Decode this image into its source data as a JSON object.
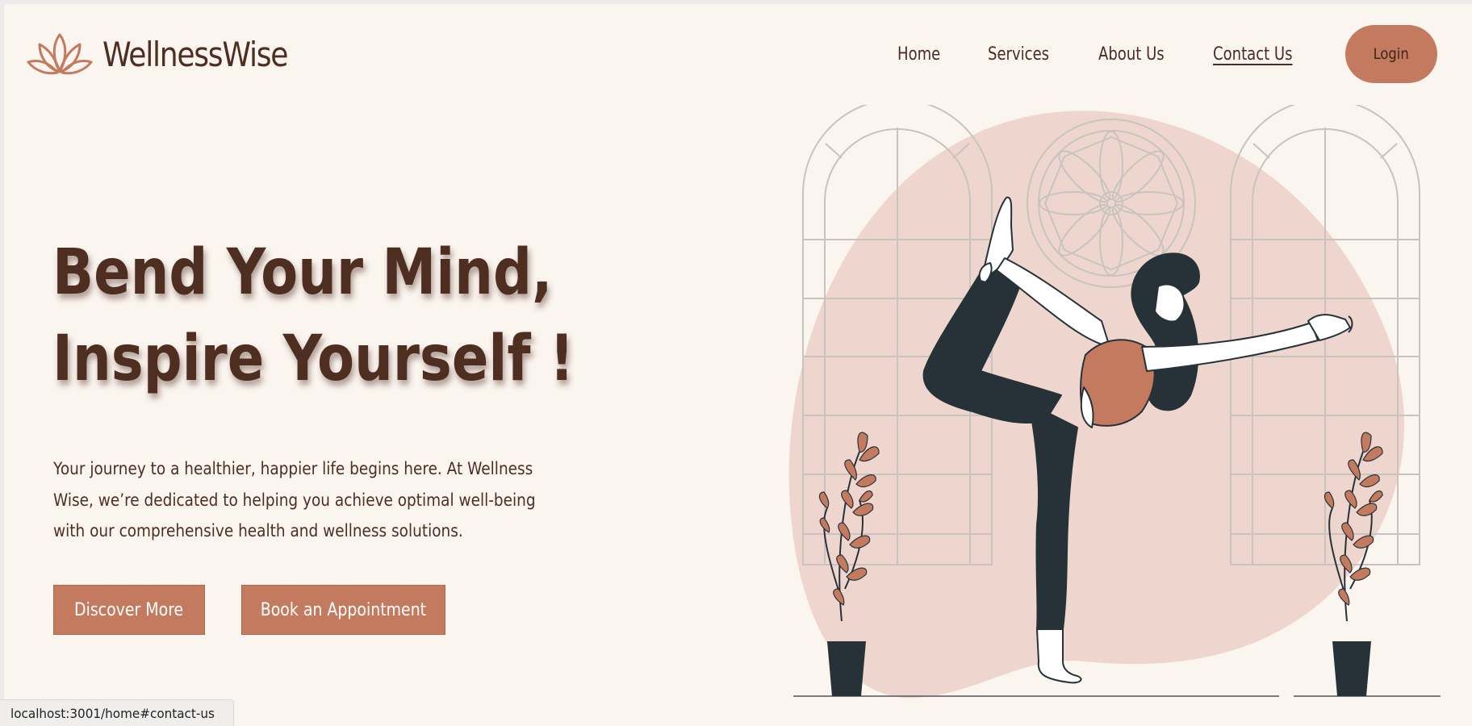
{
  "brand": {
    "name": "WellnessWise"
  },
  "nav": {
    "items": [
      {
        "label": "Home"
      },
      {
        "label": "Services"
      },
      {
        "label": "About Us"
      },
      {
        "label": "Contact Us",
        "active": true
      }
    ],
    "login_label": "Login"
  },
  "hero": {
    "title_line1": "Bend Your Mind,",
    "title_line2": "Inspire Yourself !",
    "description": "Your journey to a healthier, happier life begins here. At Wellness Wise, we’re dedicated to helping you achieve optimal well-being with our comprehensive health and wellness solutions.",
    "cta_primary": "Discover More",
    "cta_secondary": "Book an Appointment",
    "illustration": "yoga-pose-illustration"
  },
  "status_bar": {
    "url": "localhost:3001/home#contact-us"
  },
  "colors": {
    "background": "#fbf5ef",
    "accent": "#c47a5e",
    "text": "#4f2e22",
    "blob": "#eed6ce",
    "figure_dark": "#263238"
  }
}
